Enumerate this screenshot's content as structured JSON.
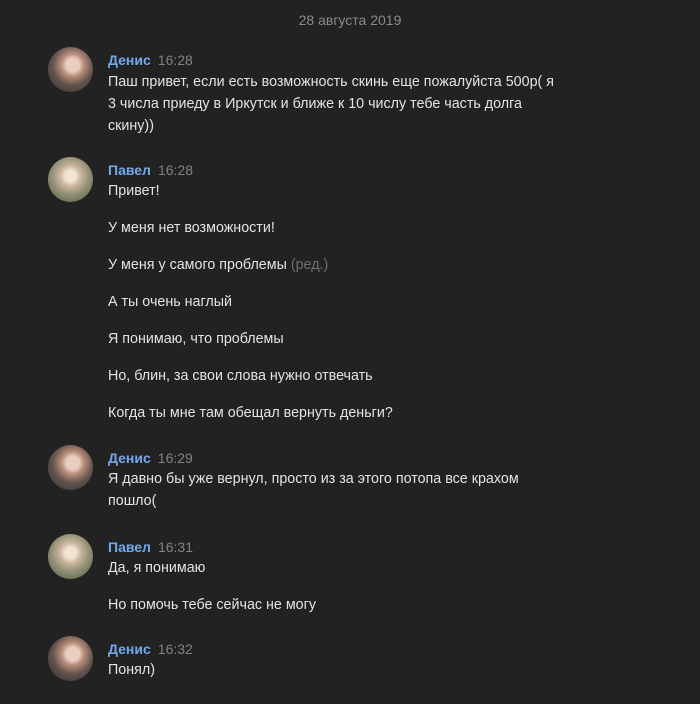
{
  "date_separator": "28 августа 2019",
  "messages": [
    {
      "author": "Денис",
      "time": "16:28",
      "avatar": "denis-avatar",
      "lines": [
        "Паш привет, если есть возможность скинь еще пожалуйста 500р( я",
        "3 числа приеду в Иркутск и ближе к 10 числу тебе часть долга",
        "скину))"
      ]
    },
    {
      "author": "Павел",
      "time": "16:28",
      "avatar": "pavel-avatar",
      "lines": [
        "Привет!",
        "У меня нет возможности!",
        "У меня у самого проблемы",
        "А ты очень наглый",
        "Я понимаю, что проблемы",
        "Но, блин, за свои слова нужно отвечать",
        "Когда ты мне там обещал вернуть деньги?"
      ],
      "edited_label": "(ред.)"
    },
    {
      "author": "Денис",
      "time": "16:29",
      "avatar": "denis-avatar",
      "lines": [
        "Я давно бы уже вернул, просто из за этого потопа все крахом",
        "пошло("
      ]
    },
    {
      "author": "Павел",
      "time": "16:31",
      "avatar": "pavel-avatar",
      "lines": [
        "Да, я понимаю",
        "Но помочь тебе сейчас не могу"
      ]
    },
    {
      "author": "Денис",
      "time": "16:32",
      "avatar": "denis-avatar",
      "lines": [
        "Понял)"
      ]
    }
  ],
  "colors": {
    "background": "#222223",
    "author": "#71aaeb",
    "text": "#e1e3e6",
    "muted": "#828282"
  }
}
